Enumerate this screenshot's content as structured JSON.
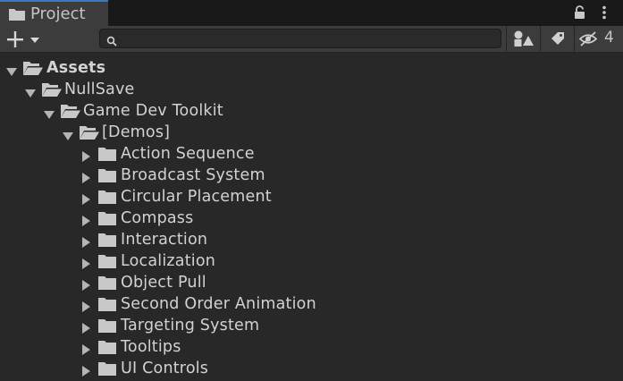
{
  "tab": {
    "title": "Project"
  },
  "header": {
    "hidden_packages_count": "4"
  },
  "search": {
    "value": "",
    "placeholder": ""
  },
  "tree": {
    "assets": "Assets",
    "nullsave": "NullSave",
    "game_dev_toolkit": "Game Dev Toolkit",
    "demos": "[Demos]",
    "demo_folders": [
      "Action Sequence",
      "Broadcast System",
      "Circular Placement",
      "Compass",
      "Interaction",
      "Localization",
      "Object Pull",
      "Second Order Animation",
      "Targeting System",
      "Tooltips",
      "UI Controls"
    ]
  },
  "icons": {
    "tab": "folder-icon",
    "lock": "lock-icon",
    "menu": "kebab-menu-icon",
    "create": "plus-icon",
    "search": "search-icon",
    "filter_type": "filter-by-type-icon",
    "filter_label": "tag-icon",
    "hidden": "eye-slash-icon",
    "folder_open": "folder-open-icon",
    "folder_closed": "folder-icon",
    "expanded": "triangle-down-icon",
    "collapsed": "triangle-right-icon"
  },
  "colors": {
    "background": "#282828",
    "toolbar": "#3c3c3c",
    "tab_accent": "#3a79bb",
    "text": "#d2d2d2"
  }
}
